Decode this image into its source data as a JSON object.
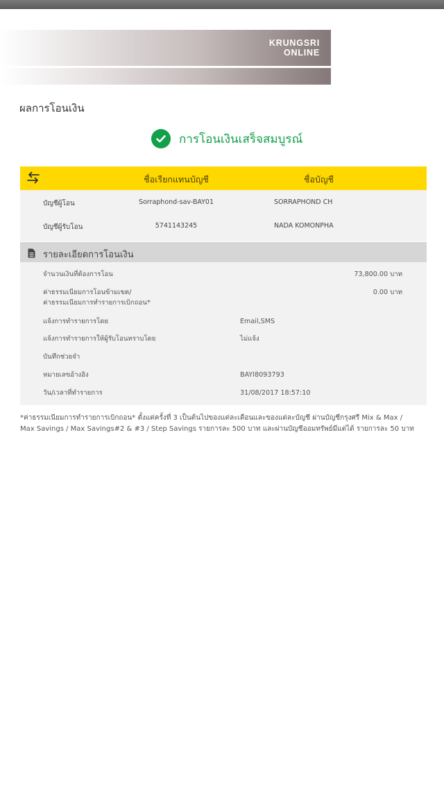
{
  "brand": {
    "line1": "KRUNGSRI",
    "line2": "ONLINE"
  },
  "page_title": "ผลการโอนเงิน",
  "status": {
    "text": "การโอนเงินเสร็จสมบูรณ์"
  },
  "accounts": {
    "header": {
      "nickname_col": "ชื่อเรียกแทนบัญชี",
      "name_col": "ชื่อบัญชี"
    },
    "rows": [
      {
        "label": "บัญชีผู้โอน",
        "nickname": "Sorraphond-sav-BAY01",
        "name": "SORRAPHOND CH"
      },
      {
        "label": "บัญชีผู้รับโอน",
        "nickname": "5741143245",
        "name": "NADA KOMONPHA"
      }
    ]
  },
  "details": {
    "title": "รายละเอียดการโอนเงิน",
    "amount": {
      "label": "จำนวนเงินที่ต้องการโอน",
      "value": "73,800.00 บาท"
    },
    "fee": {
      "label_line1": "ค่าธรรมเนียมการโอนข้ามเขต/",
      "label_line2": "ค่าธรรมเนียมการทำรายการเบิกถอน*",
      "value": "0.00 บาท"
    },
    "notify": {
      "label": "แจ้งการทำรายการโดย",
      "value": "Email,SMS"
    },
    "notify_recipient": {
      "label": "แจ้งการทำรายการให้ผู้รับโอนทราบโดย",
      "value": "ไม่แจ้ง"
    },
    "memo": {
      "label": "บันทึกช่วยจำ",
      "value": ""
    },
    "reference": {
      "label": "หมายเลขอ้างอิง",
      "value": "BAYI8093793"
    },
    "datetime": {
      "label": "วัน/เวลาที่ทำรายการ",
      "value": "31/08/2017 18:57:10"
    }
  },
  "footnote": {
    "line1": "*ค่าธรรมเนียมการทำรายการเบิกถอน* ตั้งแต่ครั้งที่ 3 เป็นต้นไปของแต่ละเดือนและของแต่ละบัญชี ผ่านบัญชีกรุงศรี Mix & Max /",
    "line2": "Max Savings / Max Savings#2 & #3 / Step Savings รายการละ 500 บาท และผ่านบัญชีออมทรัพย์มีแต่ได้ รายการละ 50 บาท"
  },
  "colors": {
    "accent_yellow": "#ffd800",
    "success_green": "#12a04a",
    "panel_gray": "#f2f2f2",
    "header_gray": "#d6d6d6"
  },
  "icons": {
    "status": "check-circle-icon",
    "transfer": "transfer-arrows-icon",
    "details": "document-icon"
  }
}
